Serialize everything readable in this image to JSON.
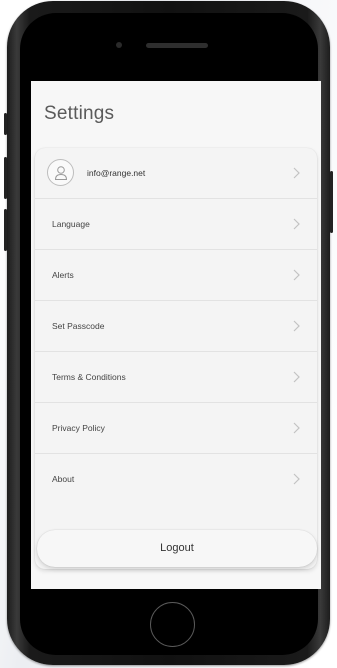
{
  "screen": {
    "title": "Settings"
  },
  "account": {
    "email": "info@range.net"
  },
  "menu": {
    "items": [
      {
        "label": "Language"
      },
      {
        "label": "Alerts"
      },
      {
        "label": "Set Passcode"
      },
      {
        "label": "Terms & Conditions"
      },
      {
        "label": "Privacy Policy"
      },
      {
        "label": "About"
      }
    ]
  },
  "actions": {
    "logout_label": "Logout"
  },
  "icons": {
    "avatar": "user-icon",
    "chevron": "chevron-right-icon"
  },
  "colors": {
    "screen_background": "#f7f7f7",
    "phone_frame": "#111111",
    "text": "#444444"
  }
}
